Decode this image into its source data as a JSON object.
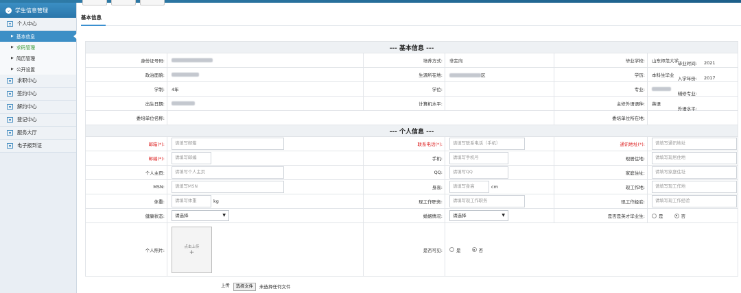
{
  "sidebar": {
    "title": "学生信息管理",
    "groups": [
      {
        "label": "个人中心",
        "icon": "doc-icon",
        "items": [
          "基本信息",
          "求码管理",
          "简历管理",
          "公开设置"
        ]
      },
      {
        "label": "求职中心",
        "icon": "chat-icon"
      },
      {
        "label": "签约中心",
        "icon": "edit-icon"
      },
      {
        "label": "解约中心",
        "icon": "calendar-icon"
      },
      {
        "label": "登记中心",
        "icon": "list-icon"
      },
      {
        "label": "服务大厅",
        "icon": "chat-icon"
      },
      {
        "label": "电子报到证",
        "icon": "edit-icon"
      }
    ]
  },
  "tab": "基本信息",
  "basic": {
    "title": "--- 基本信息 ---",
    "id_label": "身份证号码:",
    "train_label": "培养方式:",
    "train_value": "非定向",
    "school_label": "毕业学校:",
    "school_value": "山东师范大学",
    "gradtime_label": "毕业时间:",
    "gradtime_value": "2021",
    "political_label": "政治面貌:",
    "origin_label": "生源所在地:",
    "origin_value_suffix": "区",
    "edu_label": "学历:",
    "edu_value": "本科生毕业",
    "enroll_label": "入学年份:",
    "enroll_value": "2017",
    "system_label": "学制:",
    "system_value": "4年",
    "degree_label": "学位:",
    "major_label": "专业:",
    "minor_label": "辅修专业:",
    "birth_label": "出生日期:",
    "computer_label": "计算机水平:",
    "lang_label": "主修外语语种:",
    "lang_value": "英语",
    "lang_level_label": "外语水平:",
    "employer_label": "委培单位名称:",
    "employer_addr_label": "委培单位所在地:"
  },
  "personal": {
    "title": "--- 个人信息 ---",
    "email": {
      "label": "邮箱(*):",
      "ph": "请填写邮箱"
    },
    "phone": {
      "label": "联系电话(*):",
      "ph": "请填写联系电话（手机）"
    },
    "address": {
      "label": "通讯地址(*):",
      "ph": "请填写通讯地址"
    },
    "zip": {
      "label": "邮编(*):",
      "ph": "请填写邮编"
    },
    "mobile": {
      "label": "手机:",
      "ph": "请填写手机号"
    },
    "current_addr": {
      "label": "现居住地:",
      "ph": "请填写现居住地"
    },
    "homepage": {
      "label": "个人主页:",
      "ph": "请填写个人主页"
    },
    "qq": {
      "label": "QQ:",
      "ph": "请填写QQ"
    },
    "home_addr": {
      "label": "家庭住址:",
      "ph": "请填写家庭住址"
    },
    "msn": {
      "label": "MSN:",
      "ph": "请填写MSN"
    },
    "height": {
      "label": "身高:",
      "ph": "请填写身高",
      "unit": "cm"
    },
    "work_place": {
      "label": "现工作地:",
      "ph": "请填写现工作地"
    },
    "weight": {
      "label": "体重:",
      "ph": "请填写体重",
      "unit": "kg"
    },
    "job": {
      "label": "现工作职务:",
      "ph": "请填写现工作职务"
    },
    "experience": {
      "label": "现工作经验:",
      "ph": "请填写现工作经验"
    },
    "health": {
      "label": "健康状态:",
      "value": "请选择"
    },
    "marriage": {
      "label": "婚姻情况:",
      "value": "请选择"
    },
    "talent": {
      "label": "是否是英才毕业生:",
      "yes": "是",
      "no": "否",
      "selected": "否"
    },
    "photo": {
      "label": "个人照片:",
      "placeholder": "点击上传",
      "plus": "+",
      "upload_btn": "上传",
      "choose_btn": "选择文件",
      "no_file": "未选择任何文件"
    },
    "visible": {
      "label": "是否可见:",
      "yes": "是",
      "no": "否",
      "selected": "否"
    }
  }
}
